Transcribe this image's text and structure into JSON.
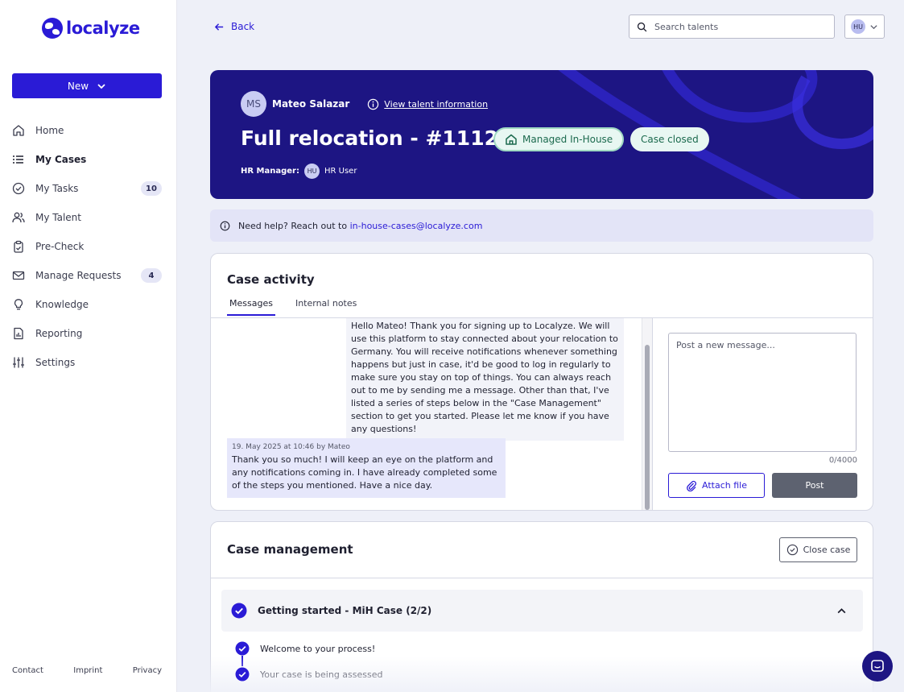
{
  "brand": {
    "name": "localyze"
  },
  "sidebar": {
    "new_button": "New",
    "items": [
      {
        "label": "Home",
        "icon": "home-icon",
        "badge": null
      },
      {
        "label": "My Cases",
        "icon": "list-icon",
        "badge": null,
        "active": true
      },
      {
        "label": "My Tasks",
        "icon": "check-circle-icon",
        "badge": "10"
      },
      {
        "label": "My Talent",
        "icon": "users-icon",
        "badge": null
      },
      {
        "label": "Pre-Check",
        "icon": "clipboard-icon",
        "badge": null
      },
      {
        "label": "Manage Requests",
        "icon": "mail-icon",
        "badge": "4"
      },
      {
        "label": "Knowledge",
        "icon": "lightbulb-icon",
        "badge": null
      },
      {
        "label": "Reporting",
        "icon": "report-icon",
        "badge": null
      },
      {
        "label": "Settings",
        "icon": "sliders-icon",
        "badge": null
      }
    ],
    "footer": {
      "contact": "Contact",
      "imprint": "Imprint",
      "privacy": "Privacy"
    }
  },
  "topbar": {
    "back": "Back",
    "search_placeholder": "Search talents",
    "user_initials": "HU"
  },
  "hero": {
    "talent_initials": "MS",
    "talent_name": "Mateo Salazar",
    "talent_link": "View talent information",
    "title": "Full relocation - #11124",
    "badge_managed": "Managed In-House",
    "badge_status": "Case closed",
    "hr_label": "HR Manager:",
    "hr_initials": "HU",
    "hr_name": "HR User"
  },
  "help": {
    "text": "Need help? Reach out to",
    "email": "in-house-cases@localyze.com"
  },
  "activity": {
    "title": "Case activity",
    "tabs": [
      "Messages",
      "Internal notes"
    ],
    "messages": [
      {
        "text": "Hello Mateo! Thank you for signing up to Localyze. We will use this platform to stay connected about your relocation to Germany. You will receive notifications whenever something happens but just in case, it'd be good to log in regularly to make sure you stay on top of things. You can always reach out to me by sending me a message. Other than that, I've listed a series of steps below in the \"Case Management\" section to get you started. Please let me know if you have any questions!"
      },
      {
        "meta": "19. May 2025 at 10:46 by Mateo",
        "text": "Thank you so much! I will keep an eye on the platform and any notifications coming in. I have already completed some of the steps you mentioned. Have a nice day."
      }
    ],
    "compose_placeholder": "Post a new message...",
    "counter": "0/4000",
    "attach_label": "Attach file",
    "post_label": "Post"
  },
  "management": {
    "title": "Case management",
    "close_label": "Close case",
    "group_title": "Getting started - MiH Case (2/2)",
    "steps": [
      "Welcome to your process!",
      "Your case is being assessed"
    ]
  },
  "colors": {
    "primary": "#2a1bd6",
    "hero_bg": "#1d1583",
    "badge_bg": "#e8f7f2",
    "badge_text": "#1c6a4e"
  }
}
